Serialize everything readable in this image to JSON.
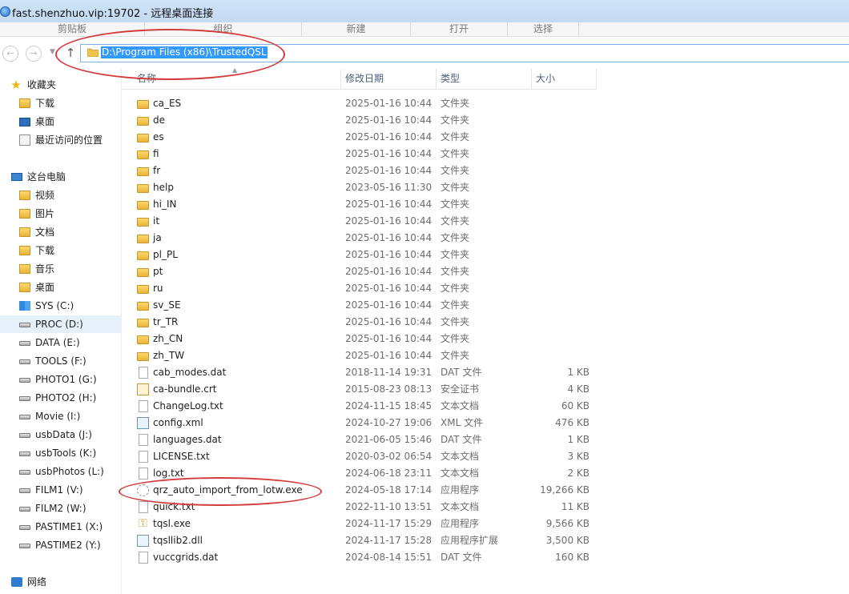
{
  "window": {
    "title": "fast.shenzhuo.vip:19702 - 远程桌面连接"
  },
  "ribbon": {
    "groups": [
      "剪贴板",
      "组织",
      "新建",
      "打开",
      "选择"
    ]
  },
  "navigation": {
    "back_icon": "back-arrow-icon",
    "forward_icon": "forward-arrow-icon",
    "up_icon": "up-arrow-icon",
    "address_path": "D:\\Program Files (x86)\\TrustedQSL"
  },
  "sidebar": {
    "favorites_label": "收藏夹",
    "favorites": [
      "下载",
      "桌面",
      "最近访问的位置"
    ],
    "pc_label": "这台电脑",
    "pc_items": [
      "视频",
      "图片",
      "文档",
      "下载",
      "音乐",
      "桌面"
    ],
    "drives": [
      "SYS (C:)",
      "PROC (D:)",
      "DATA (E:)",
      "TOOLS (F:)",
      "PHOTO1 (G:)",
      "PHOTO2 (H:)",
      "Movie (I:)",
      "usbData (J:)",
      "usbTools (K:)",
      "usbPhotos (L:)",
      "FILM1 (V:)",
      "FILM2 (W:)",
      "PASTIME1 (X:)",
      "PASTIME2 (Y:)"
    ],
    "selected_drive": "PROC (D:)",
    "network_label": "网络"
  },
  "columns": {
    "name": "名称",
    "date": "修改日期",
    "type": "类型",
    "size": "大小"
  },
  "files": [
    {
      "name": "ca_ES",
      "date": "2025-01-16 10:44",
      "type": "文件夹",
      "size": "",
      "icon": "folder-icon"
    },
    {
      "name": "de",
      "date": "2025-01-16 10:44",
      "type": "文件夹",
      "size": "",
      "icon": "folder-icon"
    },
    {
      "name": "es",
      "date": "2025-01-16 10:44",
      "type": "文件夹",
      "size": "",
      "icon": "folder-icon"
    },
    {
      "name": "fi",
      "date": "2025-01-16 10:44",
      "type": "文件夹",
      "size": "",
      "icon": "folder-icon"
    },
    {
      "name": "fr",
      "date": "2025-01-16 10:44",
      "type": "文件夹",
      "size": "",
      "icon": "folder-icon"
    },
    {
      "name": "help",
      "date": "2023-05-16 11:30",
      "type": "文件夹",
      "size": "",
      "icon": "folder-icon"
    },
    {
      "name": "hi_IN",
      "date": "2025-01-16 10:44",
      "type": "文件夹",
      "size": "",
      "icon": "folder-icon"
    },
    {
      "name": "it",
      "date": "2025-01-16 10:44",
      "type": "文件夹",
      "size": "",
      "icon": "folder-icon"
    },
    {
      "name": "ja",
      "date": "2025-01-16 10:44",
      "type": "文件夹",
      "size": "",
      "icon": "folder-icon"
    },
    {
      "name": "pl_PL",
      "date": "2025-01-16 10:44",
      "type": "文件夹",
      "size": "",
      "icon": "folder-icon"
    },
    {
      "name": "pt",
      "date": "2025-01-16 10:44",
      "type": "文件夹",
      "size": "",
      "icon": "folder-icon"
    },
    {
      "name": "ru",
      "date": "2025-01-16 10:44",
      "type": "文件夹",
      "size": "",
      "icon": "folder-icon"
    },
    {
      "name": "sv_SE",
      "date": "2025-01-16 10:44",
      "type": "文件夹",
      "size": "",
      "icon": "folder-icon"
    },
    {
      "name": "tr_TR",
      "date": "2025-01-16 10:44",
      "type": "文件夹",
      "size": "",
      "icon": "folder-icon"
    },
    {
      "name": "zh_CN",
      "date": "2025-01-16 10:44",
      "type": "文件夹",
      "size": "",
      "icon": "folder-icon"
    },
    {
      "name": "zh_TW",
      "date": "2025-01-16 10:44",
      "type": "文件夹",
      "size": "",
      "icon": "folder-icon"
    },
    {
      "name": "cab_modes.dat",
      "date": "2018-11-14 19:31",
      "type": "DAT 文件",
      "size": "1 KB",
      "icon": "dat-file-icon"
    },
    {
      "name": "ca-bundle.crt",
      "date": "2015-08-23 08:13",
      "type": "安全证书",
      "size": "4 KB",
      "icon": "certificate-icon"
    },
    {
      "name": "ChangeLog.txt",
      "date": "2024-11-15 18:45",
      "type": "文本文档",
      "size": "60 KB",
      "icon": "text-file-icon"
    },
    {
      "name": "config.xml",
      "date": "2024-10-27 19:06",
      "type": "XML 文件",
      "size": "476 KB",
      "icon": "xml-file-icon"
    },
    {
      "name": "languages.dat",
      "date": "2021-06-05 15:46",
      "type": "DAT 文件",
      "size": "1 KB",
      "icon": "dat-file-icon"
    },
    {
      "name": "LICENSE.txt",
      "date": "2020-03-02 06:54",
      "type": "文本文档",
      "size": "3 KB",
      "icon": "text-file-icon"
    },
    {
      "name": "log.txt",
      "date": "2024-06-18 23:11",
      "type": "文本文档",
      "size": "2 KB",
      "icon": "text-file-icon"
    },
    {
      "name": "qrz_auto_import_from_lotw.exe",
      "date": "2024-05-18 17:14",
      "type": "应用程序",
      "size": "19,266 KB",
      "icon": "exe-icon"
    },
    {
      "name": "quick.txt",
      "date": "2022-11-10 13:51",
      "type": "文本文档",
      "size": "11 KB",
      "icon": "text-file-icon"
    },
    {
      "name": "tqsl.exe",
      "date": "2024-11-17 15:29",
      "type": "应用程序",
      "size": "9,566 KB",
      "icon": "key-icon"
    },
    {
      "name": "tqsllib2.dll",
      "date": "2024-11-17 15:28",
      "type": "应用程序扩展",
      "size": "3,500 KB",
      "icon": "dll-icon"
    },
    {
      "name": "vuccgrids.dat",
      "date": "2024-08-14 15:51",
      "type": "DAT 文件",
      "size": "160 KB",
      "icon": "dat-file-icon"
    }
  ],
  "colors": {
    "titlebar": "#c8deF4",
    "selection": "#3399ff",
    "annotation": "#d43b3b",
    "sidebar_selected": "#e5f0fb"
  }
}
